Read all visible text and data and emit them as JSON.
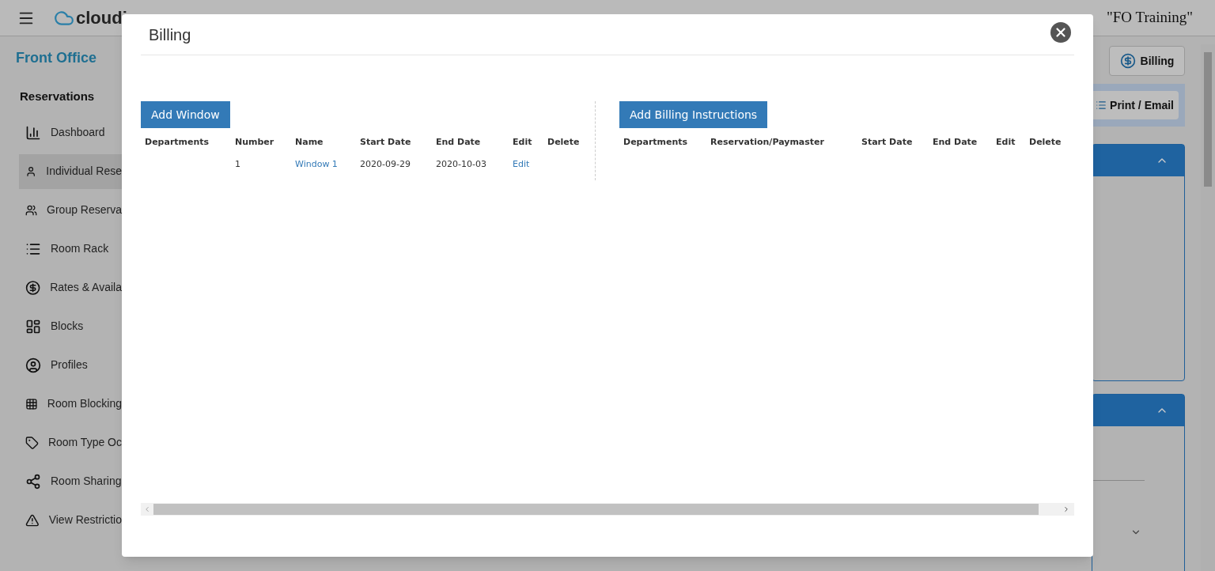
{
  "header": {
    "logo": "cloudi",
    "hotel": "\"FO Training\""
  },
  "sidebar": {
    "title": "Front Office",
    "section": "Reservations",
    "items": [
      {
        "label": "Dashboard",
        "selected": false
      },
      {
        "label": "Individual Rese",
        "selected": true
      },
      {
        "label": "Group Reserva",
        "selected": false
      },
      {
        "label": "Room Rack",
        "selected": false
      },
      {
        "label": "Rates & Availa",
        "selected": false
      },
      {
        "label": "Blocks",
        "selected": false
      },
      {
        "label": "Profiles",
        "selected": false
      },
      {
        "label": "Room Blocking",
        "selected": false
      },
      {
        "label": "Room Type Oc",
        "selected": false
      },
      {
        "label": "Room Sharing",
        "selected": false
      },
      {
        "label": "View Restrictio",
        "selected": false
      }
    ]
  },
  "toolbar": {
    "billing_button": "Billing",
    "print_button": "Print / Email"
  },
  "dialog": {
    "title": "Billing",
    "windows": {
      "button": "Add Window",
      "columns": [
        "Departments",
        "Number",
        "Name",
        "Start Date",
        "End Date",
        "Edit",
        "Delete"
      ],
      "rows": [
        {
          "number": "1",
          "name": "Window 1",
          "start_date": "2020-09-29",
          "end_date": "2020-10-03",
          "edit": "Edit"
        }
      ]
    },
    "instructions": {
      "button": "Add Billing Instructions",
      "columns": [
        "Departments",
        "Reservation/Paymaster",
        "Start Date",
        "End Date",
        "Edit",
        "Delete"
      ]
    }
  }
}
